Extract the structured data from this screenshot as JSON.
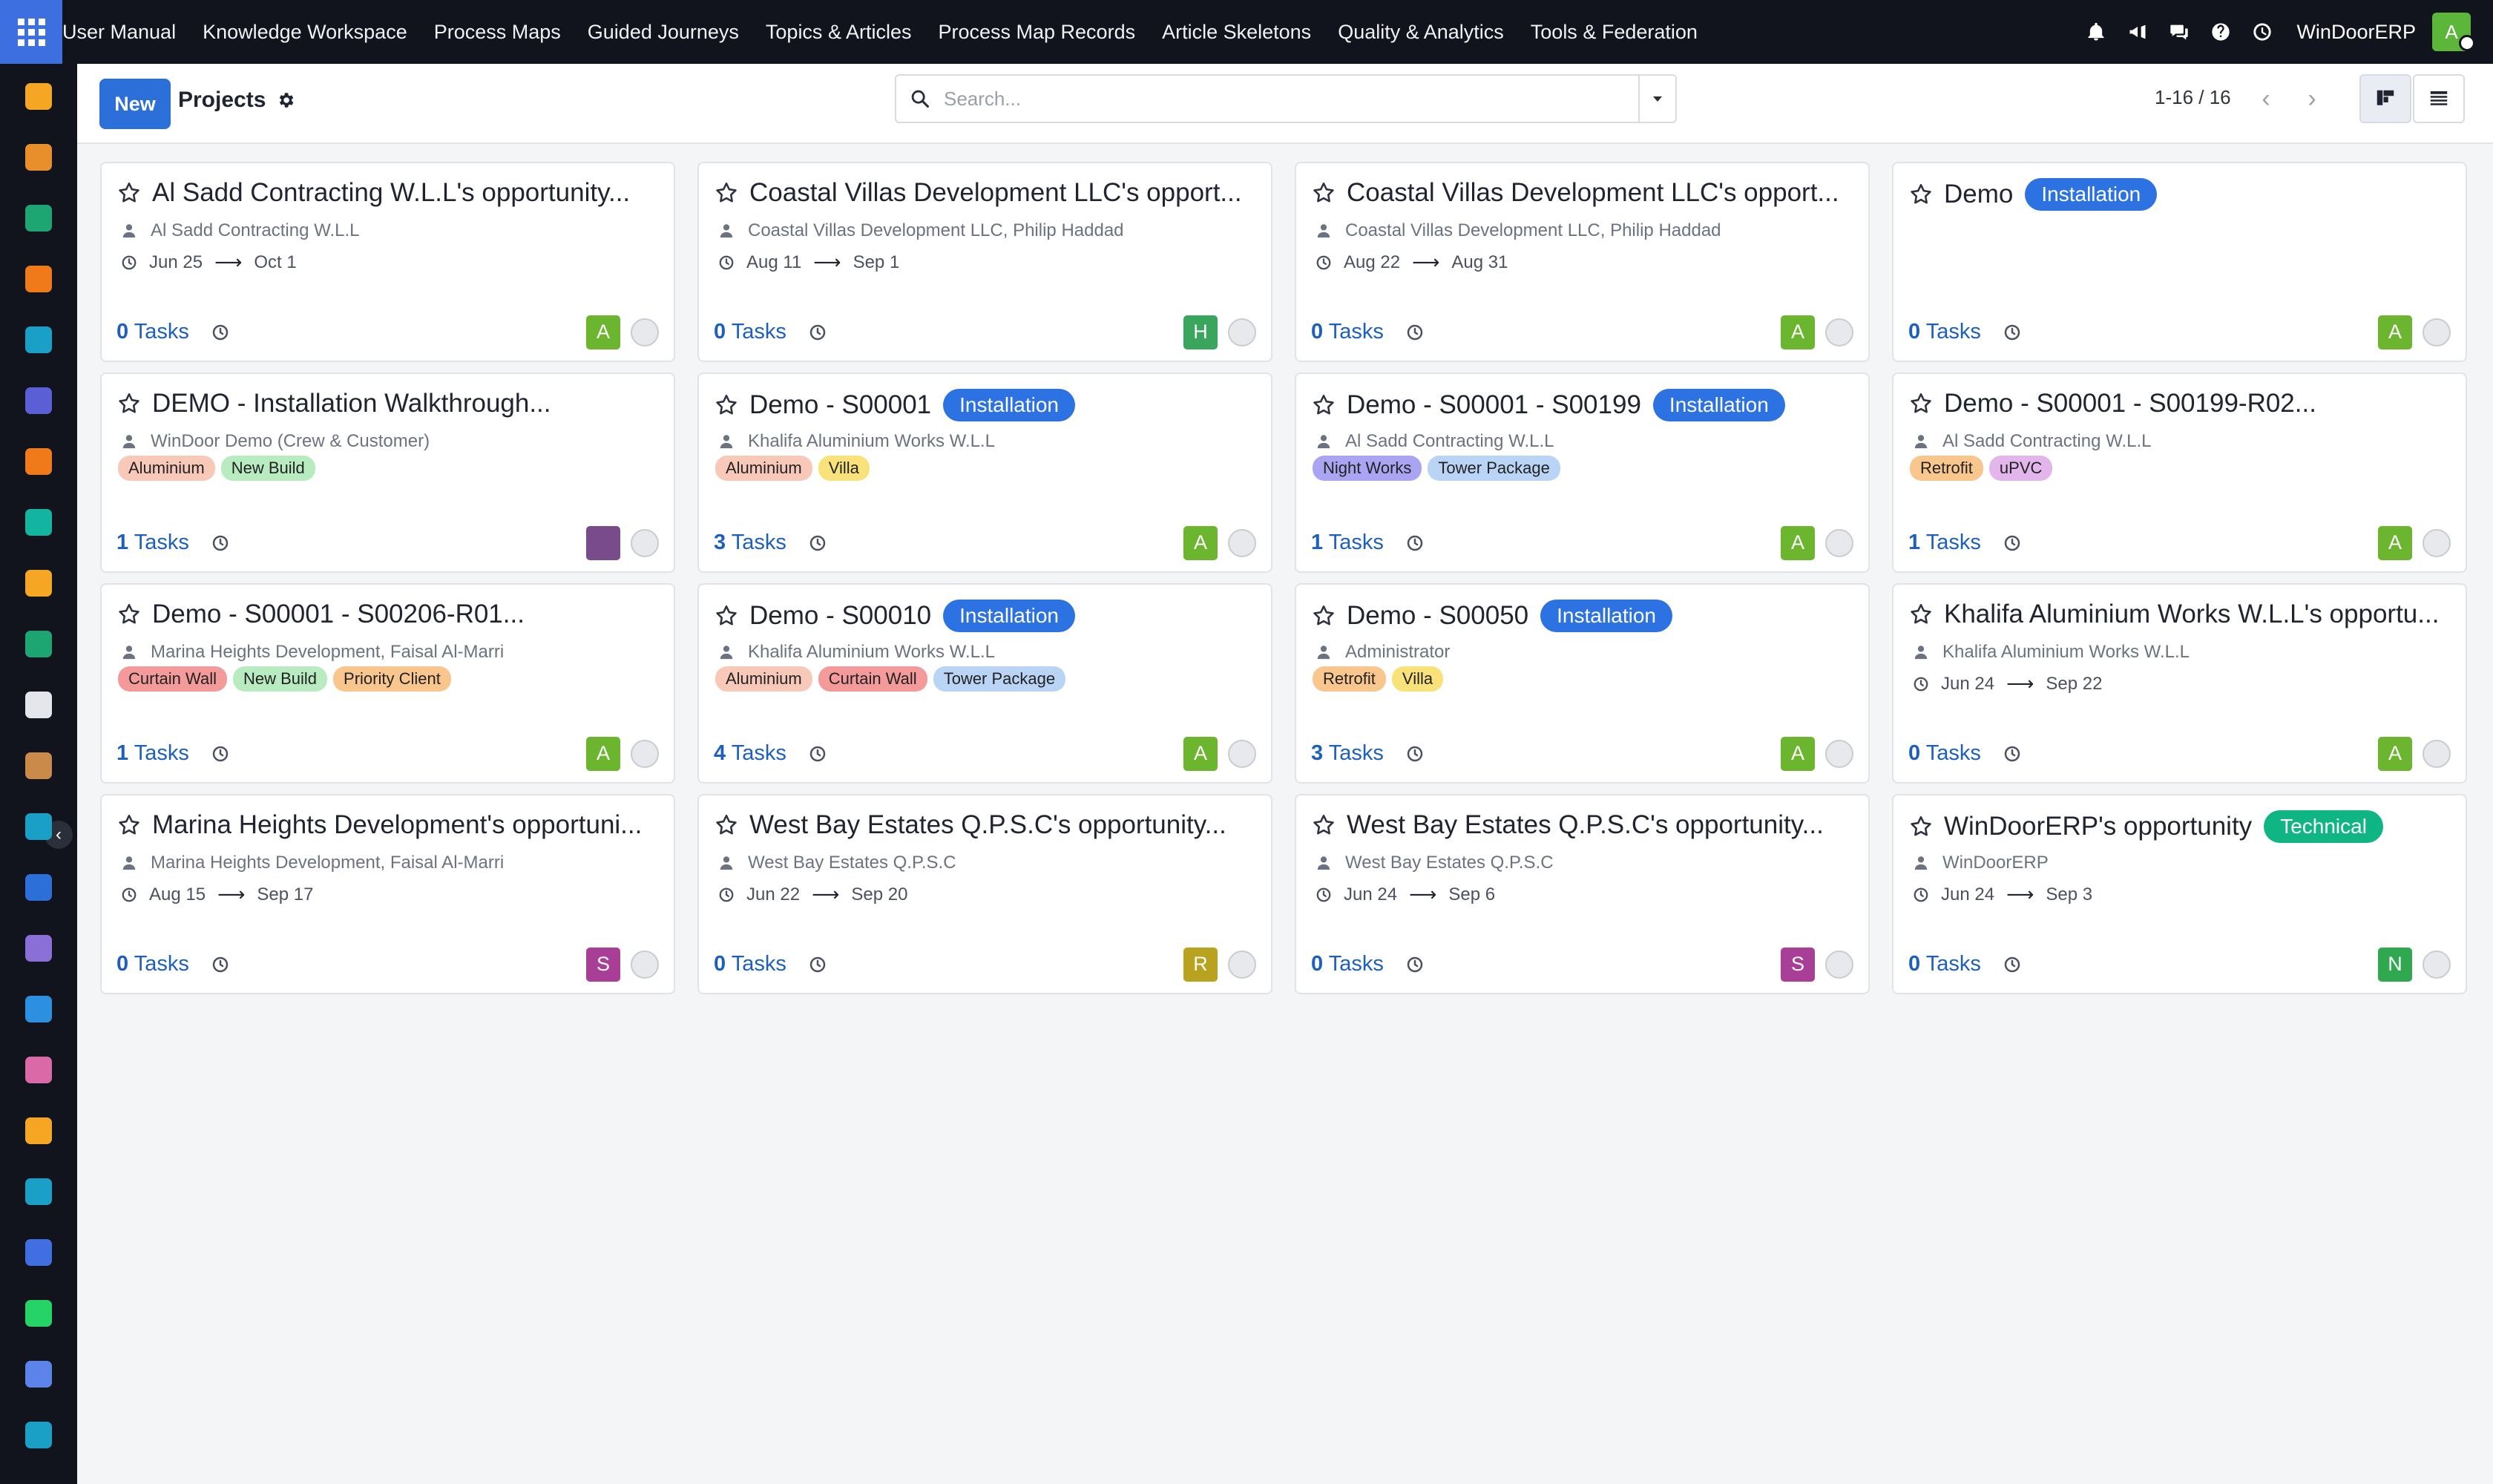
{
  "topbar": {
    "menu": [
      "User Manual",
      "Knowledge Workspace",
      "Process Maps",
      "Guided Journeys",
      "Topics & Articles",
      "Process Map Records",
      "Article Skeletons",
      "Quality & Analytics",
      "Tools & Federation"
    ],
    "company": "WinDoorERP",
    "user_initial": "A",
    "icons": [
      "bell-icon",
      "megaphone-icon",
      "chat-icon",
      "help-icon",
      "clock-icon"
    ]
  },
  "sidebar": {
    "colors": [
      "#f5a623",
      "#e88f2c",
      "#1ea672",
      "#f07a1a",
      "#1aa0c7",
      "#5b5fd6",
      "#f07a1a",
      "#13b5a0",
      "#f5a623",
      "#1ea672",
      "#e4e6eb",
      "#c98a4a",
      "#1aa0c7",
      "#2c6fd8",
      "#8a6fd6",
      "#2c8fe0",
      "#d96aa7",
      "#f5a623",
      "#1aa0c7",
      "#3f6fe0",
      "#25d366",
      "#5b83e8",
      "#1aa0c7"
    ]
  },
  "control": {
    "new_label": "New",
    "breadcrumb": "Projects",
    "search_placeholder": "Search...",
    "pager": "1-16 / 16"
  },
  "cards": [
    {
      "title": "Al Sadd Contracting W.L.L's opportunity...",
      "stage": "",
      "sub": "Al Sadd Contracting W.L.L",
      "start": "Jun 25",
      "end": "Oct 1",
      "tags": [],
      "tasks_n": "0",
      "avatar": "A",
      "avatar_color": "#6cb52f"
    },
    {
      "title": "Coastal Villas Development LLC's opport...",
      "stage": "",
      "sub": "Coastal Villas Development LLC, Philip Haddad",
      "start": "Aug 11",
      "end": "Sep 1",
      "tags": [],
      "tasks_n": "0",
      "avatar": "H",
      "avatar_color": "#3aa55c"
    },
    {
      "title": "Coastal Villas Development LLC's opport...",
      "stage": "",
      "sub": "Coastal Villas Development LLC, Philip Haddad",
      "start": "Aug 22",
      "end": "Aug 31",
      "tags": [],
      "tasks_n": "0",
      "avatar": "A",
      "avatar_color": "#6cb52f"
    },
    {
      "title": "Demo",
      "stage": "Installation",
      "sub": "",
      "start": "",
      "end": "",
      "tags": [],
      "tasks_n": "0",
      "avatar": "A",
      "avatar_color": "#6cb52f"
    },
    {
      "title": "DEMO - Installation Walkthrough...",
      "stage": "",
      "sub": "WinDoor Demo (Crew & Customer)",
      "start": "",
      "end": "",
      "tags": [
        {
          "label": "Aluminium",
          "color": "#f8c9b8"
        },
        {
          "label": "New Build",
          "color": "#b8ebc0"
        }
      ],
      "tasks_n": "1",
      "avatar": "",
      "avatar_color": "#7a4b8a"
    },
    {
      "title": "Demo - S00001",
      "stage": "Installation",
      "sub": "Khalifa Aluminium Works W.L.L",
      "start": "",
      "end": "",
      "tags": [
        {
          "label": "Aluminium",
          "color": "#f8c9b8"
        },
        {
          "label": "Villa",
          "color": "#f9e27a"
        }
      ],
      "tasks_n": "3",
      "avatar": "A",
      "avatar_color": "#6cb52f"
    },
    {
      "title": "Demo - S00001 - S00199",
      "stage": "Installation",
      "sub": "Al Sadd Contracting W.L.L",
      "start": "",
      "end": "",
      "tags": [
        {
          "label": "Night Works",
          "color": "#a9a5f2"
        },
        {
          "label": "Tower Package",
          "color": "#b9d4f5"
        }
      ],
      "tasks_n": "1",
      "avatar": "A",
      "avatar_color": "#6cb52f"
    },
    {
      "title": "Demo - S00001 - S00199-R02...",
      "stage": "",
      "sub": "Al Sadd Contracting W.L.L",
      "start": "",
      "end": "",
      "tags": [
        {
          "label": "Retrofit",
          "color": "#f9c68e"
        },
        {
          "label": "uPVC",
          "color": "#e2b6ea"
        }
      ],
      "tasks_n": "1",
      "avatar": "A",
      "avatar_color": "#6cb52f"
    },
    {
      "title": "Demo - S00001 - S00206-R01...",
      "stage": "",
      "sub": "Marina Heights Development, Faisal Al-Marri",
      "start": "",
      "end": "",
      "tags": [
        {
          "label": "Curtain Wall",
          "color": "#f59a9a"
        },
        {
          "label": "New Build",
          "color": "#b8ebc0"
        },
        {
          "label": "Priority Client",
          "color": "#f9c68e"
        }
      ],
      "tasks_n": "1",
      "avatar": "A",
      "avatar_color": "#6cb52f"
    },
    {
      "title": "Demo - S00010",
      "stage": "Installation",
      "sub": "Khalifa Aluminium Works W.L.L",
      "start": "",
      "end": "",
      "tags": [
        {
          "label": "Aluminium",
          "color": "#f8c9b8"
        },
        {
          "label": "Curtain Wall",
          "color": "#f59a9a"
        },
        {
          "label": "Tower Package",
          "color": "#b9d4f5"
        }
      ],
      "tasks_n": "4",
      "avatar": "A",
      "avatar_color": "#6cb52f"
    },
    {
      "title": "Demo - S00050",
      "stage": "Installation",
      "sub": "Administrator",
      "start": "",
      "end": "",
      "tags": [
        {
          "label": "Retrofit",
          "color": "#f9c68e"
        },
        {
          "label": "Villa",
          "color": "#f9e27a"
        }
      ],
      "tasks_n": "3",
      "avatar": "A",
      "avatar_color": "#6cb52f"
    },
    {
      "title": "Khalifa Aluminium Works W.L.L's opportu...",
      "stage": "",
      "sub": "Khalifa Aluminium Works W.L.L",
      "start": "Jun 24",
      "end": "Sep 22",
      "tags": [],
      "tasks_n": "0",
      "avatar": "A",
      "avatar_color": "#6cb52f"
    },
    {
      "title": "Marina Heights Development's opportuni...",
      "stage": "",
      "sub": "Marina Heights Development, Faisal Al-Marri",
      "start": "Aug 15",
      "end": "Sep 17",
      "tags": [],
      "tasks_n": "0",
      "avatar": "S",
      "avatar_color": "#a83e95"
    },
    {
      "title": "West Bay Estates Q.P.S.C's opportunity...",
      "stage": "",
      "sub": "West Bay Estates Q.P.S.C",
      "start": "Jun 22",
      "end": "Sep 20",
      "tags": [],
      "tasks_n": "0",
      "avatar": "R",
      "avatar_color": "#b8a21e"
    },
    {
      "title": "West Bay Estates Q.P.S.C's opportunity...",
      "stage": "",
      "sub": "West Bay Estates Q.P.S.C",
      "start": "Jun 24",
      "end": "Sep 6",
      "tags": [],
      "tasks_n": "0",
      "avatar": "S",
      "avatar_color": "#a83e95"
    },
    {
      "title": "WinDoorERP's opportunity",
      "stage": "Technical",
      "sub": "WinDoorERP",
      "start": "Jun 24",
      "end": "Sep 3",
      "tags": [],
      "tasks_n": "0",
      "avatar": "N",
      "avatar_color": "#2fa84f"
    }
  ],
  "labels": {
    "tasks_word": "Tasks"
  }
}
